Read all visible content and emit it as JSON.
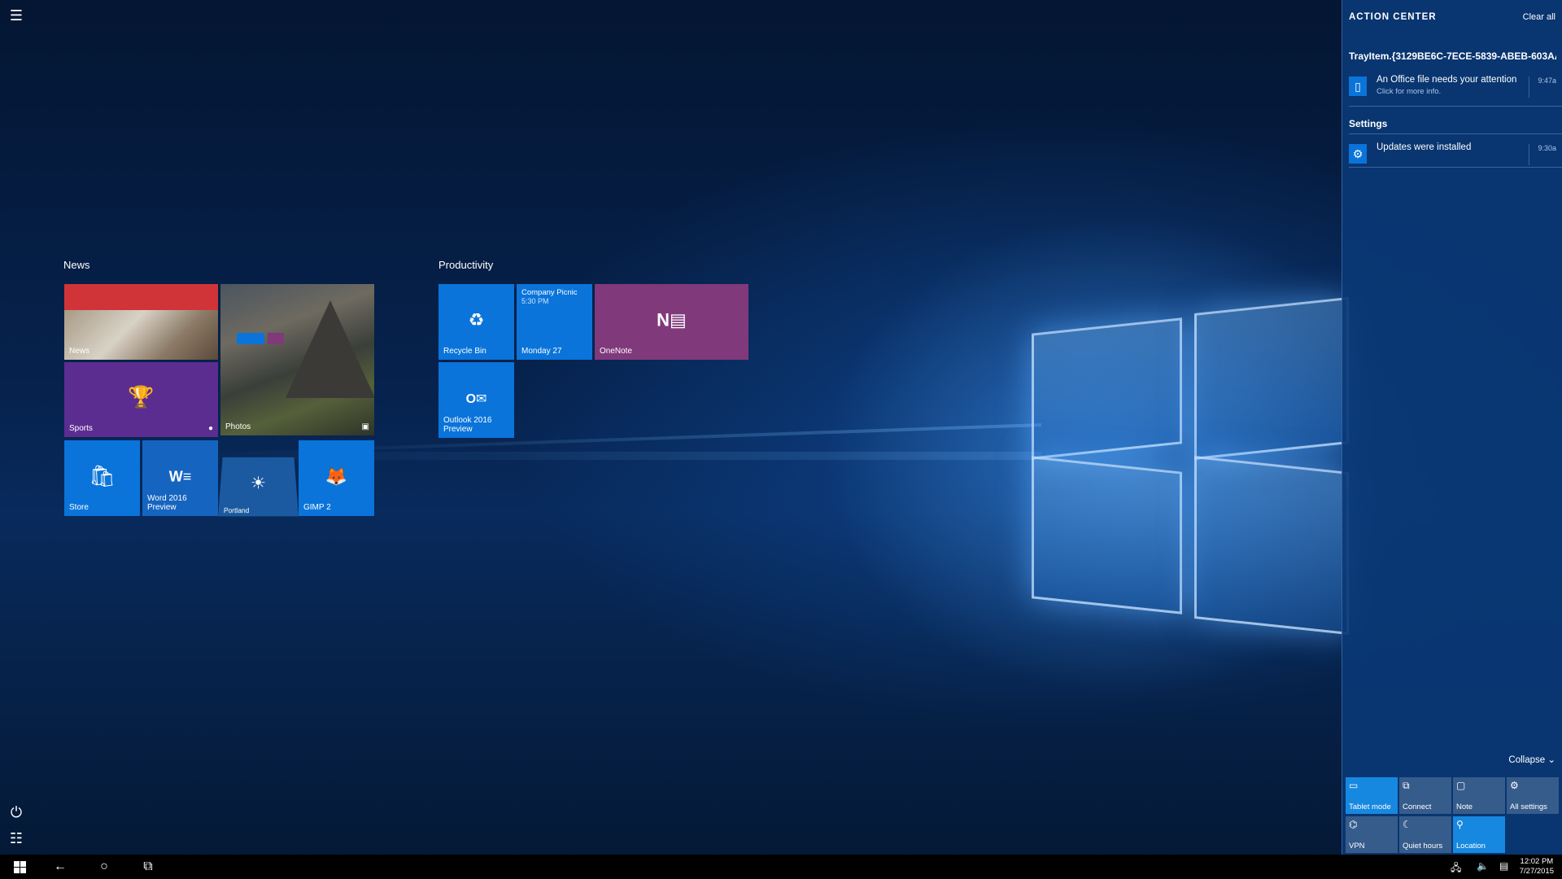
{
  "groups": {
    "news": "News",
    "productivity": "Productivity"
  },
  "tiles": {
    "news": "News",
    "photos": "Photos",
    "sports": "Sports",
    "store": "Store",
    "word": "Word 2016 Preview",
    "weather": "Portland",
    "gimp": "GIMP 2",
    "recycle": "Recycle Bin",
    "calendar_event": "Company Picnic",
    "calendar_time": "5:30 PM",
    "calendar_day": "Monday 27",
    "onenote": "OneNote",
    "outlook": "Outlook 2016 Preview"
  },
  "action_center": {
    "title": "ACTION CENTER",
    "clear_all": "Clear all",
    "group1": "TrayItem.{3129BE6C-7ECE-5839-ABEB-603AA4A",
    "notif1_title": "An Office file needs your attention",
    "notif1_sub": "Click for more info.",
    "notif1_time": "9:47a",
    "group2": "Settings",
    "notif2_title": "Updates were installed",
    "notif2_time": "9:30a",
    "collapse": "Collapse",
    "quick_actions": [
      {
        "label": "Tablet mode",
        "icon": "tablet-icon",
        "on": true
      },
      {
        "label": "Connect",
        "icon": "connect-icon",
        "on": false
      },
      {
        "label": "Note",
        "icon": "note-icon",
        "on": false
      },
      {
        "label": "All settings",
        "icon": "gear-icon",
        "on": false
      },
      {
        "label": "VPN",
        "icon": "vpn-icon",
        "on": false
      },
      {
        "label": "Quiet hours",
        "icon": "moon-icon",
        "on": false
      },
      {
        "label": "Location",
        "icon": "location-icon",
        "on": true
      }
    ]
  },
  "taskbar": {
    "time": "12:02 PM",
    "date": "7/27/2015"
  },
  "colors": {
    "tile_blue": "#0a74da",
    "tile_purple": "#5c2d91",
    "onenote_purple": "#80397b",
    "news_red": "#d13438",
    "action_center_bg": "#0a3875"
  }
}
